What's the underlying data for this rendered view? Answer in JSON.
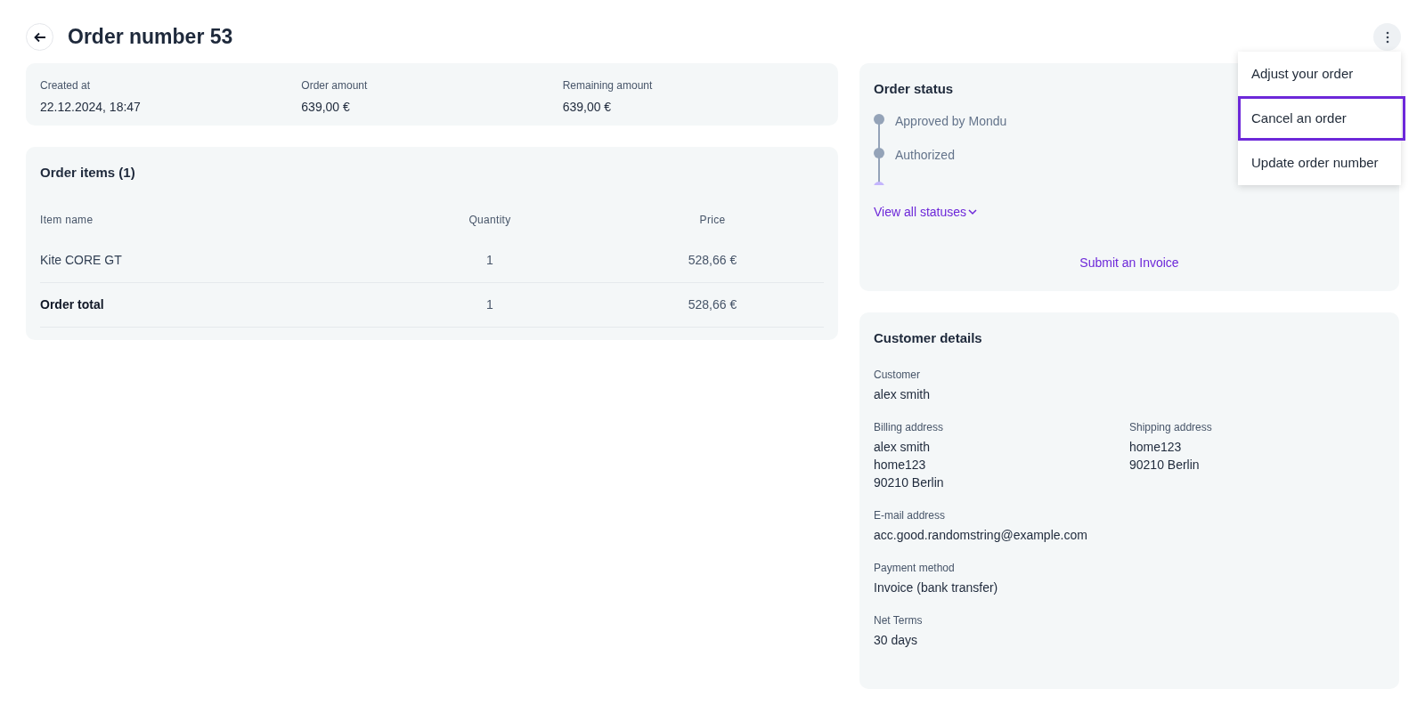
{
  "header": {
    "title": "Order number 53"
  },
  "summary": [
    {
      "label": "Created at",
      "value": "22.12.2024, 18:47"
    },
    {
      "label": "Order amount",
      "value": "639,00 €"
    },
    {
      "label": "Remaining amount",
      "value": "639,00 €"
    }
  ],
  "order_items": {
    "title": "Order items (1)",
    "columns": [
      "Item name",
      "Quantity",
      "Price"
    ],
    "rows": [
      {
        "kind": "item",
        "cells": [
          "Kite CORE GT",
          "1",
          "528,66 €"
        ]
      },
      {
        "kind": "total",
        "cells": [
          "Order total",
          "1",
          "528,66 €"
        ]
      }
    ]
  },
  "order_status": {
    "title": "Order status",
    "statuses": [
      {
        "label": "Approved by Mondu",
        "color": "#94a3b8"
      },
      {
        "label": "Authorized",
        "color": "#94a3b8"
      },
      {
        "color": "#c4b5fd"
      }
    ],
    "view_all": "View all statuses",
    "submit": "Submit an Invoice"
  },
  "menu": [
    {
      "label": "Adjust your order",
      "selected": false
    },
    {
      "label": "Cancel an order",
      "selected": true
    },
    {
      "label": "Update order number",
      "selected": false
    }
  ],
  "customer": {
    "title": "Customer details",
    "fields": [
      {
        "label": "Customer",
        "lines": [
          "alex smith"
        ]
      }
    ],
    "addresses": [
      {
        "label": "Billing address",
        "lines": [
          "alex smith",
          "home123",
          "90210 Berlin"
        ]
      },
      {
        "label": "Shipping address",
        "lines": [
          "home123",
          "90210 Berlin"
        ]
      }
    ],
    "more": [
      {
        "label": "E-mail address",
        "lines": [
          "acc.good.randomstring@example.com"
        ]
      },
      {
        "label": "Payment method",
        "lines": [
          "Invoice (bank transfer)"
        ]
      },
      {
        "label": "Net Terms",
        "lines": [
          "30 days"
        ]
      }
    ]
  }
}
